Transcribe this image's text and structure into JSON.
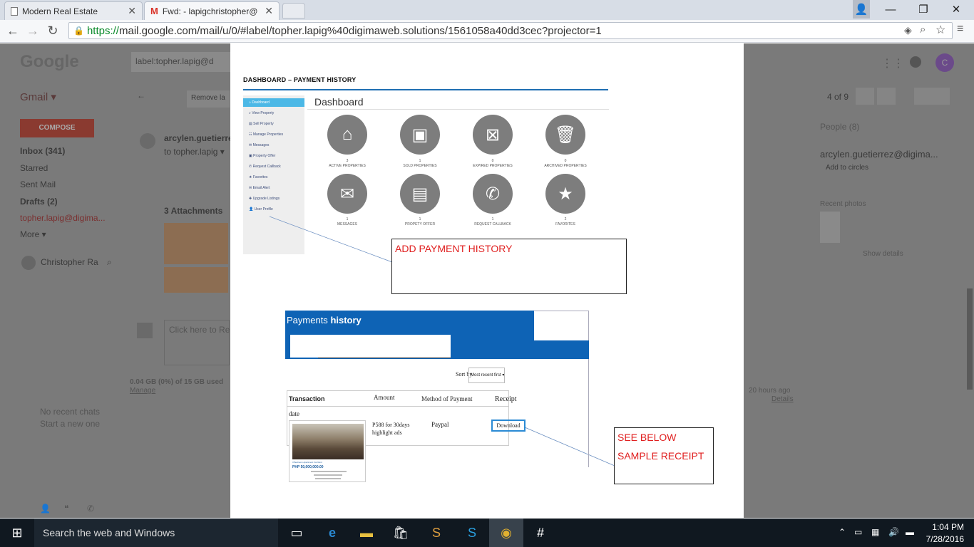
{
  "browser": {
    "tabs": [
      {
        "label": "Modern Real Estate",
        "icon": "page-icon"
      },
      {
        "label": "Fwd: - lapigchristopher@",
        "icon": "gmail-icon"
      }
    ],
    "url_scheme": "https://",
    "url_rest": "mail.google.com/mail/u/0/#label/topher.lapig%40digimaweb.solutions/1561058a40dd3cec?projector=1"
  },
  "gmail": {
    "logo": "Google",
    "search_value": "label:topher.lapig@d",
    "app": "Gmail ▾",
    "compose": "COMPOSE",
    "nav": [
      "Inbox (341)",
      "Starred",
      "Sent Mail",
      "Drafts (2)",
      "topher.lapig@digima...",
      "More ▾"
    ],
    "user": "Christopher Ra",
    "remove_label": "Remove la",
    "pagination": "4 of 9",
    "sender": "arcylen.guetierrez",
    "to": "to topher.lapig ▾",
    "attachments": "3 Attachments",
    "reply_placeholder": "Click here to Re",
    "storage": "0.04 GB (0%) of 15 GB used",
    "manage": "Manage",
    "time": "20 hours ago",
    "details": "Details",
    "no_chats": "No recent chats",
    "start_chat": "Start a new one",
    "people_header": "People (8)",
    "person": "arcylen.guetierrez@digima...",
    "add_circles": "Add to circles",
    "recent_photos": "Recent photos",
    "show_details": "Show details"
  },
  "doc": {
    "heading": "DASHBOARD – PAYMENT HISTORY",
    "dashboard_title": "Dashboard",
    "sidebar": [
      "Dashboard",
      "View Property",
      "Sell Property",
      "Manage Properties",
      "Messages",
      "Property Offer",
      "Request Callback",
      "Favorites",
      "Email Alert",
      "Upgrade Listings",
      "User Profile"
    ],
    "stats": [
      {
        "num": "3",
        "label": "ACTIVE PROPERTIES",
        "icon": "home-icon"
      },
      {
        "num": "1",
        "label": "SOLD PROPERTIES",
        "icon": "money-icon"
      },
      {
        "num": "0",
        "label": "EXPIRED PROPERTIES",
        "icon": "calendar-x-icon"
      },
      {
        "num": "0",
        "label": "ARCHIVED PROPERTIES",
        "icon": "trash-icon"
      },
      {
        "num": "1",
        "label": "MESSAGES",
        "icon": "envelope-icon"
      },
      {
        "num": "1",
        "label": "PROPETY OFFER",
        "icon": "briefcase-icon"
      },
      {
        "num": "1",
        "label": "REQUEST CALLBACK",
        "icon": "phone-icon"
      },
      {
        "num": "2",
        "label": "FAVORITES",
        "icon": "star-icon"
      }
    ],
    "note_payment": "ADD PAYMENT HISTORY",
    "payments_title_thin": "Payments",
    "payments_title_bold": "history",
    "sort_label": "Sort by",
    "sort_value": "Most recent first ▾",
    "table_headers": [
      "Transaction",
      "Amount",
      "Method of Payment",
      "Receipt"
    ],
    "row_date": "date",
    "amount": "P588 for 30days highlight ads",
    "method": "Paypal",
    "download": "Download",
    "listing_title": "3 Bedroom Apartment For Rent",
    "listing_price": "PHP 50,000,000.00",
    "note_receipt_1": "SEE BELOW",
    "note_receipt_2": "SAMPLE RECEIPT"
  },
  "taskbar": {
    "search": "Search the web and Windows",
    "time": "1:04 PM",
    "date": "7/28/2016"
  },
  "colors": {
    "dash_blue": "#1f6fb2",
    "payments_blue": "#0e63b5",
    "note_red": "#e02020",
    "sidebar_active": "#4cb8e6"
  }
}
